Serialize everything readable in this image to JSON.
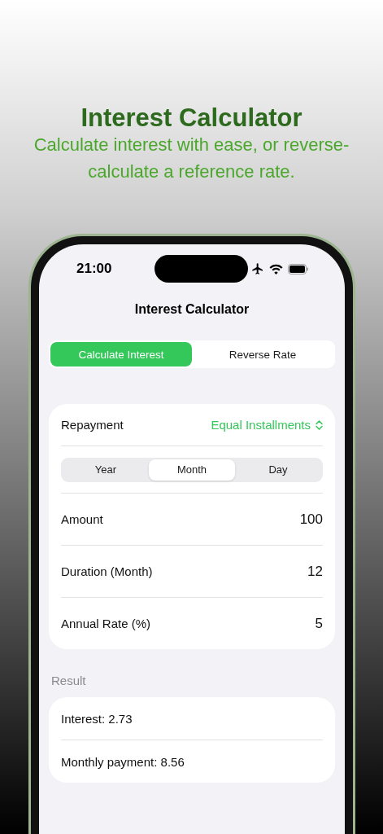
{
  "promo": {
    "title": "Interest Calculator",
    "subtitle": "Calculate interest with ease, or reverse-calculate a reference rate."
  },
  "status_bar": {
    "time": "21:00"
  },
  "nav": {
    "title": "Interest Calculator"
  },
  "mode_tabs": [
    {
      "label": "Calculate Interest",
      "selected": true
    },
    {
      "label": "Reverse Rate",
      "selected": false
    }
  ],
  "form": {
    "repayment": {
      "label": "Repayment",
      "value": "Equal Installments"
    },
    "period_tabs": [
      {
        "label": "Year",
        "selected": false
      },
      {
        "label": "Month",
        "selected": true
      },
      {
        "label": "Day",
        "selected": false
      }
    ],
    "fields": [
      {
        "label": "Amount",
        "value": "100"
      },
      {
        "label": "Duration (Month)",
        "value": "12"
      },
      {
        "label": "Annual Rate (%)",
        "value": "5"
      }
    ]
  },
  "result": {
    "header": "Result",
    "lines": [
      "Interest: 2.73",
      "Monthly payment: 8.56"
    ]
  }
}
